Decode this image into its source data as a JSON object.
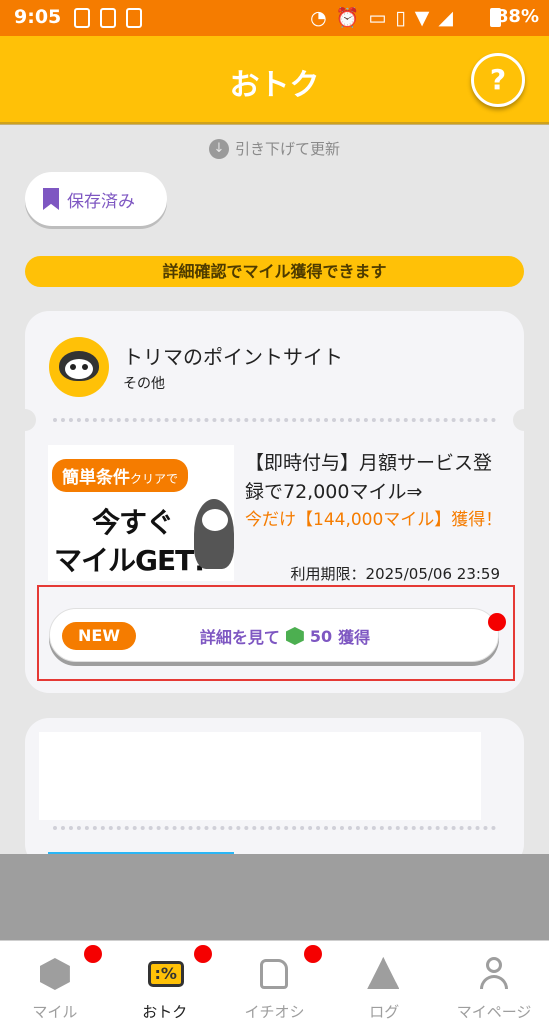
{
  "status_bar": {
    "time": "9:05",
    "battery": "88%"
  },
  "header": {
    "title": "おトク",
    "help_label": "?"
  },
  "pull_hint": "引き下げて更新",
  "saved_button": {
    "label": "保存済み"
  },
  "banner": {
    "text": "詳細確認でマイル獲得できます"
  },
  "offer_card": {
    "brand_name": "トリマのポイントサイト",
    "brand_category": "その他",
    "image_text": {
      "tag": "簡単条件",
      "tag_small": "クリアで",
      "line1": "今すぐ",
      "line2": "マイルGET!"
    },
    "title": "【即時付与】月額サービス登録で72,000マイル⇒",
    "highlight": "今だけ【144,000マイル】獲得！",
    "expiry": "利用期限：2025/05/06 23:59",
    "detail_button": {
      "badge": "NEW",
      "label": "詳細を見て",
      "points": "50",
      "suffix": "獲得"
    }
  },
  "bottom_nav": {
    "items": [
      {
        "label": "マイル",
        "icon": "mile-hex-icon",
        "badge": true,
        "active": false
      },
      {
        "label": "おトク",
        "icon": "ticket-percent-icon",
        "badge": true,
        "active": true
      },
      {
        "label": "イチオシ",
        "icon": "thumbs-up-icon",
        "badge": true,
        "active": false
      },
      {
        "label": "ログ",
        "icon": "walking-icon",
        "badge": false,
        "active": false
      },
      {
        "label": "マイページ",
        "icon": "person-icon",
        "badge": false,
        "active": false
      }
    ]
  },
  "colors": {
    "status_bar": "#f57c00",
    "header": "#ffc107",
    "accent_purple": "#7e57c2",
    "orange": "#f57c00",
    "badge_red": "#f50000"
  }
}
